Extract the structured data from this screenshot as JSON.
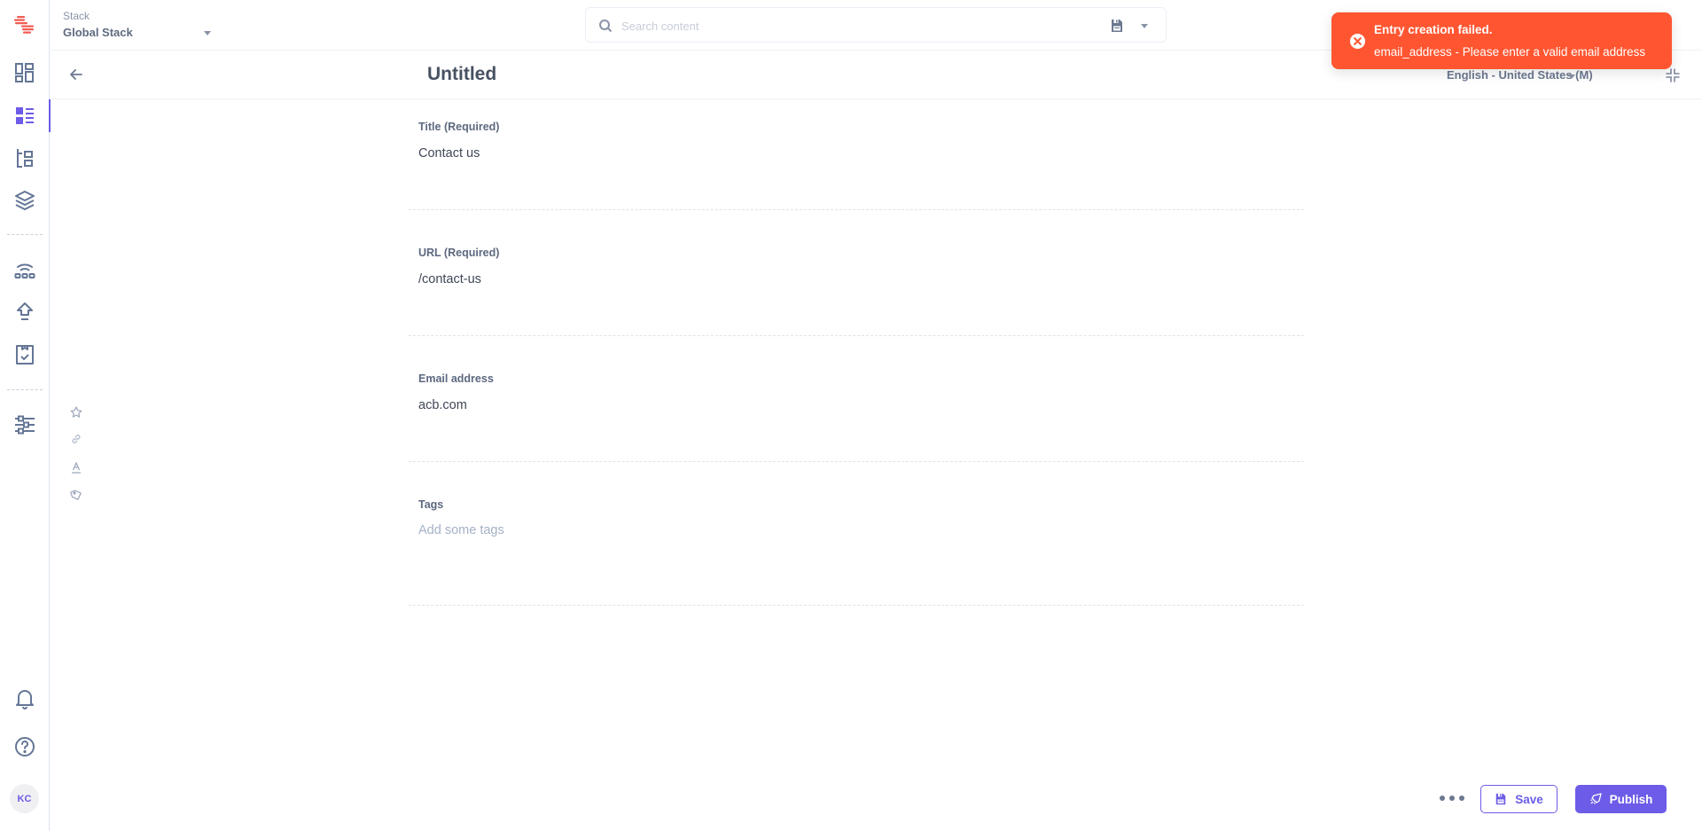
{
  "app": {
    "stack_label": "Stack",
    "stack_name": "Global Stack",
    "brand_color": "#6c5ce7",
    "error_color": "#ff5631"
  },
  "sidebar": {
    "items": [
      {
        "name": "dashboard",
        "icon": "dashboard-icon"
      },
      {
        "name": "entries",
        "icon": "entries-icon",
        "active": true
      },
      {
        "name": "content-models",
        "icon": "content-models-icon"
      },
      {
        "name": "assets",
        "icon": "layers-icon"
      },
      {
        "name": "webhooks",
        "icon": "webhooks-icon"
      },
      {
        "name": "deployments",
        "icon": "deploy-icon"
      },
      {
        "name": "tasks",
        "icon": "tasks-icon"
      },
      {
        "name": "settings",
        "icon": "settings-icon"
      },
      {
        "name": "notifications",
        "icon": "bell-icon"
      },
      {
        "name": "help",
        "icon": "help-icon"
      }
    ],
    "avatar_initials": "KC"
  },
  "search": {
    "placeholder": "Search content",
    "value": ""
  },
  "editor": {
    "title": "Untitled",
    "locale": "English - United States (M)",
    "side_tools": [
      "star-icon",
      "link-icon",
      "text-format-icon",
      "tag-icon"
    ]
  },
  "form": {
    "fields": [
      {
        "label": "Title (Required)",
        "value": "Contact us",
        "placeholder": ""
      },
      {
        "label": "URL (Required)",
        "value": "/contact-us",
        "placeholder": ""
      },
      {
        "label": "Email address",
        "value": "acb.com",
        "placeholder": ""
      },
      {
        "label": "Tags",
        "value": "",
        "placeholder": "Add some tags"
      }
    ]
  },
  "toast": {
    "title": "Entry creation failed.",
    "message": "email_address - Please enter a valid email address"
  },
  "actions": {
    "save_label": "Save",
    "publish_label": "Publish"
  }
}
